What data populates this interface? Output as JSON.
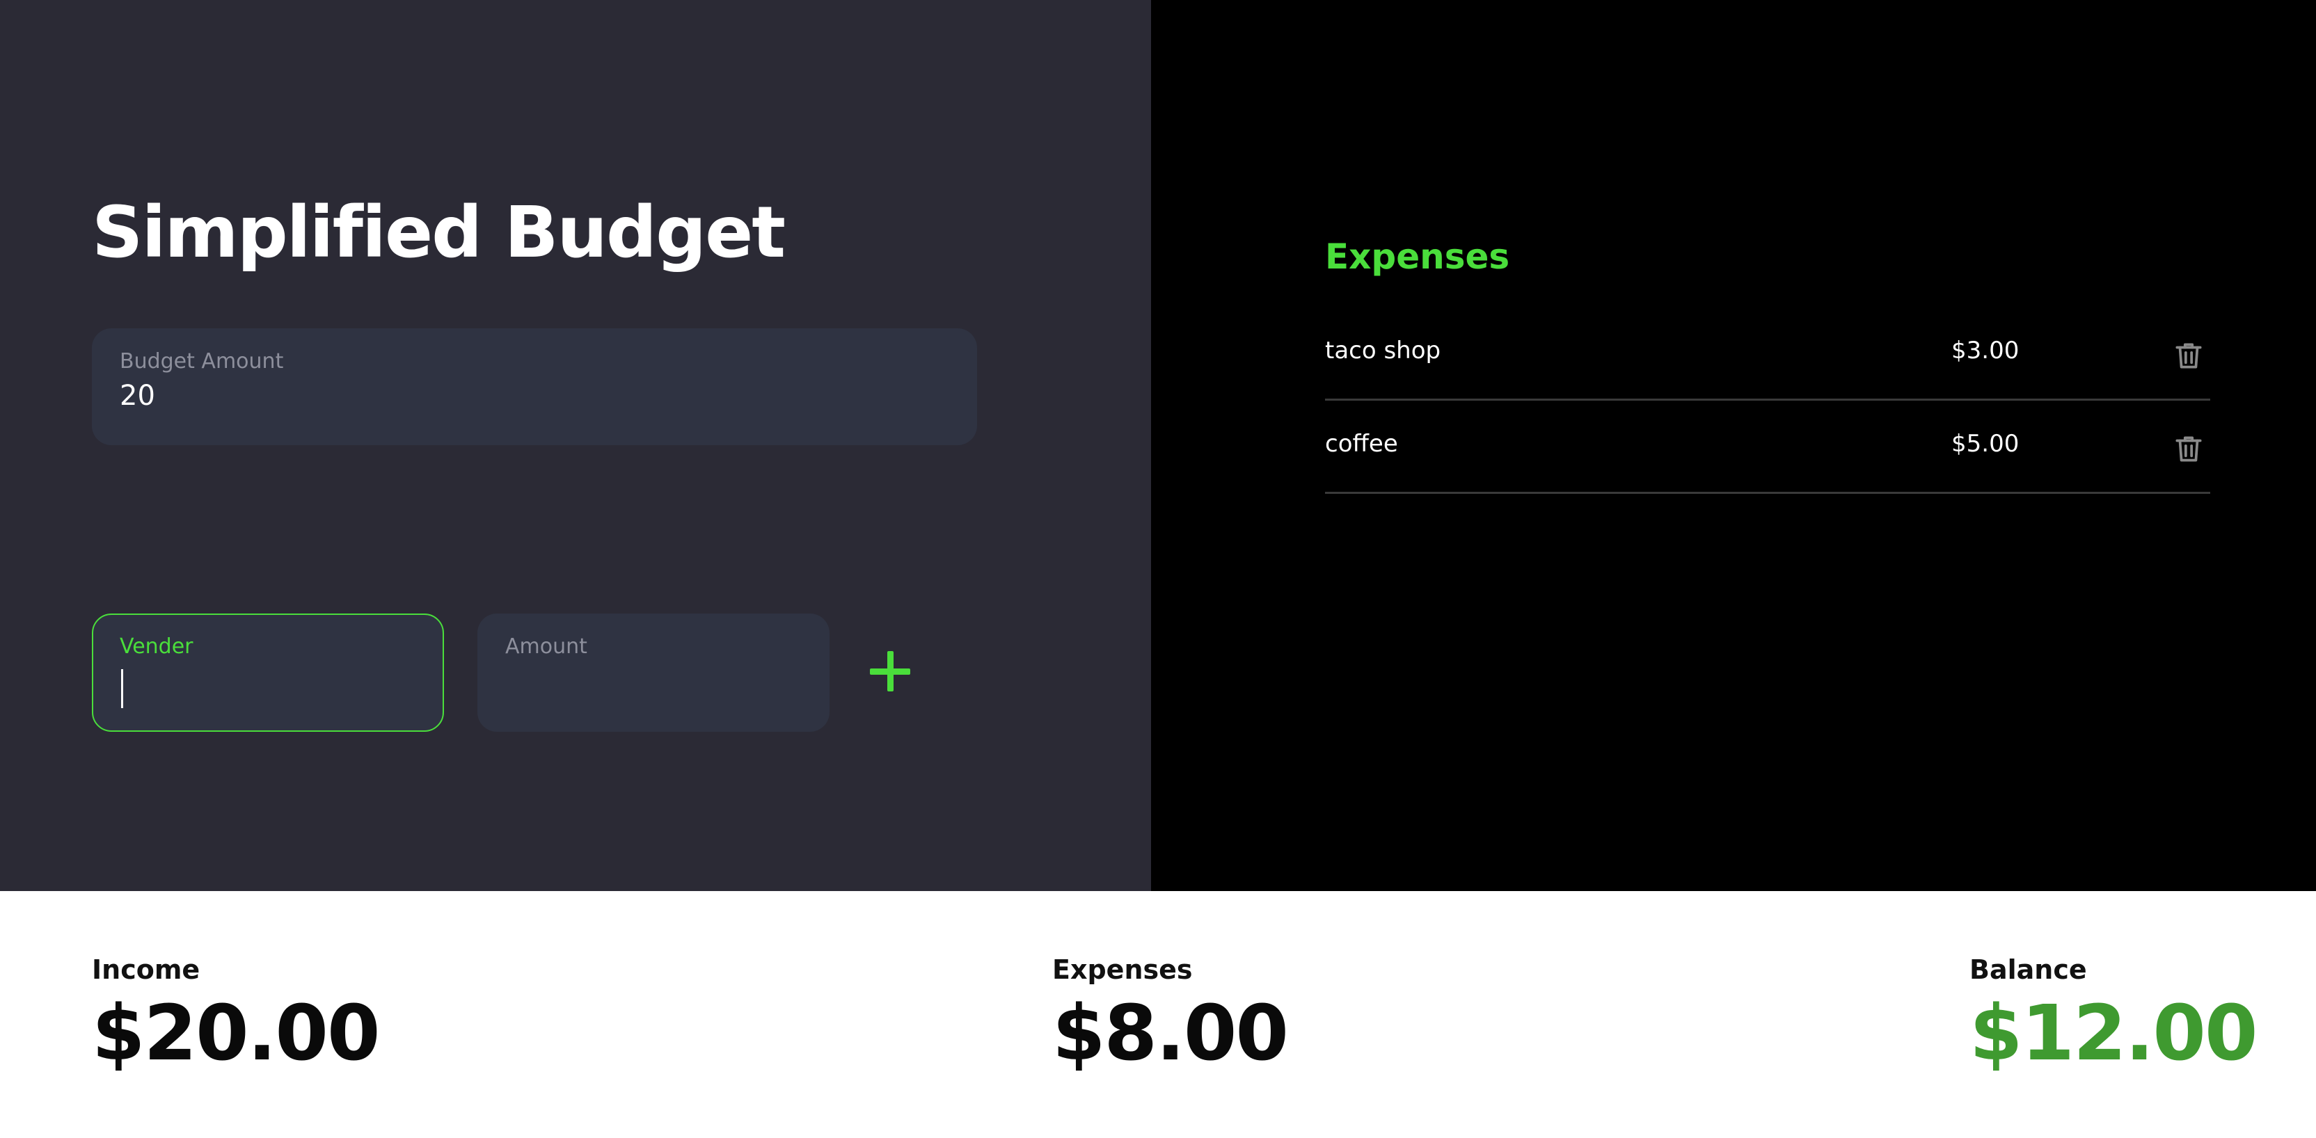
{
  "app": {
    "title": "Simplified Budget"
  },
  "budget": {
    "label": "Budget Amount",
    "value": "20"
  },
  "new_expense": {
    "vendor_label": "Vender",
    "vendor_value": "",
    "amount_label": "Amount",
    "amount_value": "",
    "add_icon": "plus-icon"
  },
  "expenses": {
    "heading": "Expenses",
    "items": [
      {
        "vendor": "taco shop",
        "amount": "$3.00",
        "delete_icon": "trash-icon"
      },
      {
        "vendor": "coffee",
        "amount": "$5.00",
        "delete_icon": "trash-icon"
      }
    ]
  },
  "summary": {
    "income_label": "Income",
    "income_value": "$20.00",
    "expenses_label": "Expenses",
    "expenses_value": "$8.00",
    "balance_label": "Balance",
    "balance_value": "$12.00"
  },
  "colors": {
    "accent": "#4ade3b",
    "left_panel_bg": "#2b2a35",
    "right_panel_bg": "#000000",
    "field_bg": "#2f3342",
    "summary_bg": "#ffffff",
    "balance_positive": "#3f9a30"
  }
}
